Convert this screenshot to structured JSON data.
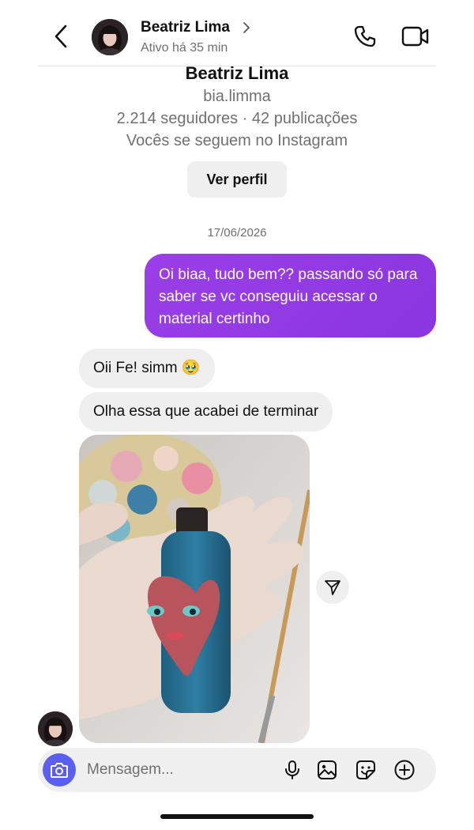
{
  "header": {
    "name": "Beatriz Lima",
    "status": "Ativo há 35 min"
  },
  "profile": {
    "name": "Beatriz Lima",
    "username": "bia.limma",
    "stats": "2.214 seguidores · 42 publicações",
    "mutual": "Vocês se seguem no Instagram",
    "view_profile_label": "Ver perfil"
  },
  "thread": {
    "date": "17/06/2026",
    "messages": [
      {
        "from": "me",
        "text": "Oi biaa, tudo bem?? passando só para saber se vc conseguiu acessar o material certinho"
      },
      {
        "from": "them",
        "text": "Oii Fe! simm 🥹"
      },
      {
        "from": "them",
        "text": "Olha essa que acabei de terminar"
      }
    ]
  },
  "composer": {
    "placeholder": "Mensagem..."
  },
  "colors": {
    "outgoing_bubble": "#8a35e0",
    "incoming_bubble": "#efefef",
    "camera_button": "#5b5ff0"
  },
  "icons": [
    "back-icon",
    "chevron-right-icon",
    "phone-icon",
    "video-icon",
    "share-icon",
    "camera-icon",
    "mic-icon",
    "gallery-icon",
    "sticker-icon",
    "plus-icon"
  ]
}
